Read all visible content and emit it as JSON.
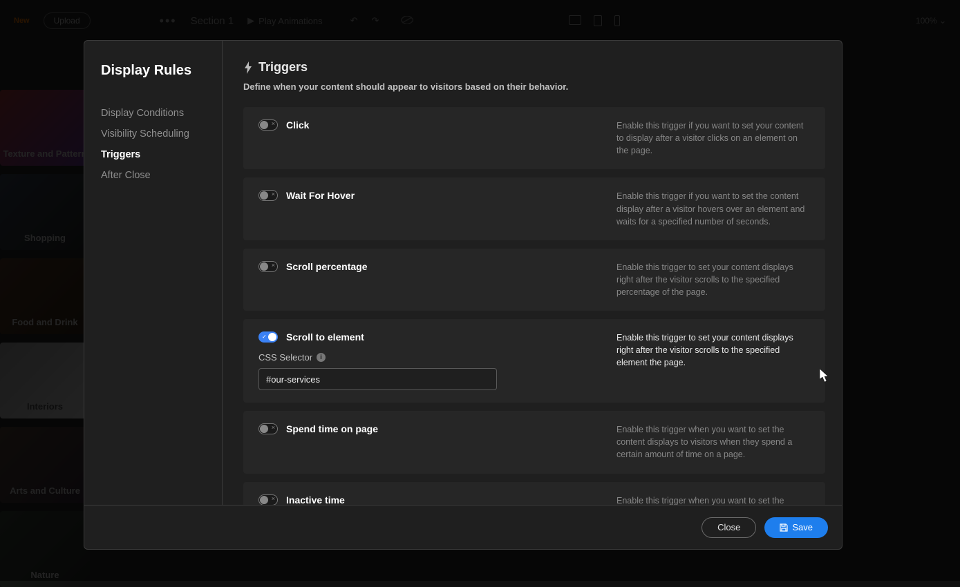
{
  "topbar": {
    "new_label": "New",
    "upload_label": "Upload",
    "section_label": "Section 1",
    "play_label": "Play Animations",
    "zoom_label": "100%"
  },
  "bg_tiles": [
    "Texture and Pattern",
    "Shopping",
    "Food and Drink",
    "Interiors",
    "Arts and Culture",
    "Nature"
  ],
  "modal": {
    "title": "Display Rules",
    "nav": [
      {
        "label": "Display Conditions",
        "active": false
      },
      {
        "label": "Visibility Scheduling",
        "active": false
      },
      {
        "label": "Triggers",
        "active": true
      },
      {
        "label": "After Close",
        "active": false
      }
    ],
    "content": {
      "heading": "Triggers",
      "description": "Define when your content should appear to visitors based on their behavior."
    },
    "triggers": [
      {
        "name": "Click",
        "enabled": false,
        "help": "Enable this trigger if you want to set your content to display after a visitor clicks on an element on the page."
      },
      {
        "name": "Wait For Hover",
        "enabled": false,
        "help": "Enable this trigger if you want to set the content display after a visitor hovers over an element and waits for a specified number of seconds."
      },
      {
        "name": "Scroll percentage",
        "enabled": false,
        "help": "Enable this trigger to set your content displays right after the visitor scrolls to the specified percentage of the page."
      },
      {
        "name": "Scroll to element",
        "enabled": true,
        "help": "Enable this trigger to set your content displays right after the visitor scrolls to the specified element the page.",
        "field_label": "CSS Selector",
        "field_value": "#our-services"
      },
      {
        "name": "Spend time on page",
        "enabled": false,
        "help": "Enable this trigger when you want to set the content displays to visitors when they spend a certain amount of time on a page."
      },
      {
        "name": "Inactive time",
        "enabled": false,
        "help": "Enable this trigger when you want to set the content displays to the visitors after they become active on the page after a certain amount of time."
      }
    ],
    "footer": {
      "close_label": "Close",
      "save_label": "Save"
    }
  }
}
